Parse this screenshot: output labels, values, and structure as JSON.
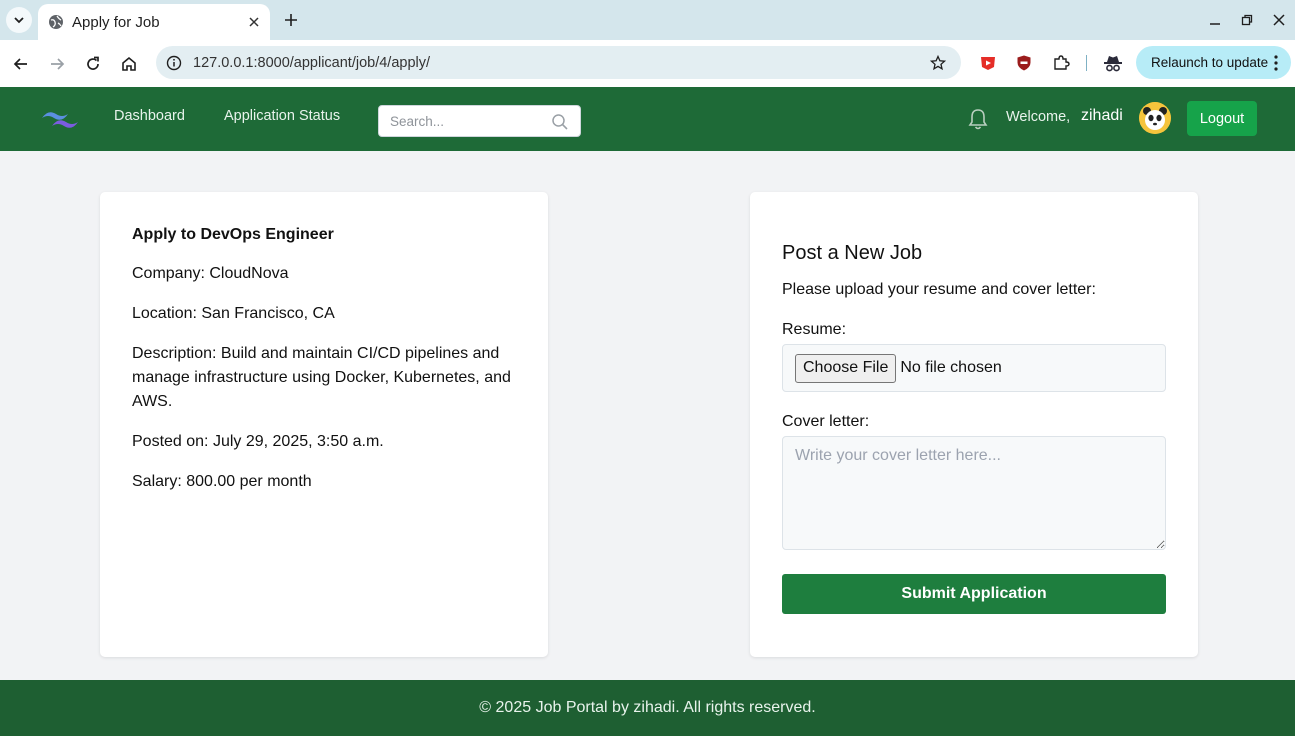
{
  "browser": {
    "tab_title": "Apply for Job",
    "url": "127.0.0.1:8000/applicant/job/4/apply/",
    "relaunch_label": "Relaunch to update"
  },
  "nav": {
    "links": [
      "Dashboard",
      "Application Status"
    ],
    "search_placeholder": "Search...",
    "welcome": "Welcome,",
    "username": "zihadi",
    "logout_label": "Logout"
  },
  "job": {
    "title": "Apply to DevOps Engineer",
    "company": "Company: CloudNova",
    "location": "Location: San Francisco, CA",
    "description": "Description: Build and maintain CI/CD pipelines and manage infrastructure using Docker, Kubernetes, and AWS.",
    "posted": "Posted on: July 29, 2025, 3:50 a.m.",
    "salary": "Salary: 800.00 per month"
  },
  "form": {
    "title": "Post a New Job",
    "intro": "Please upload your resume and cover letter:",
    "resume_label": "Resume:",
    "choose_file": "Choose File",
    "file_status": "No file chosen",
    "cover_label": "Cover letter:",
    "cover_placeholder": "Write your cover letter here...",
    "submit_label": "Submit Application"
  },
  "footer": {
    "text": "© 2025 Job Portal by zihadi. All rights reserved."
  },
  "colors": {
    "navbar": "#1e6a37",
    "footer": "#1e5f32",
    "logout": "#16a34a",
    "submit": "#1e7e3e"
  }
}
